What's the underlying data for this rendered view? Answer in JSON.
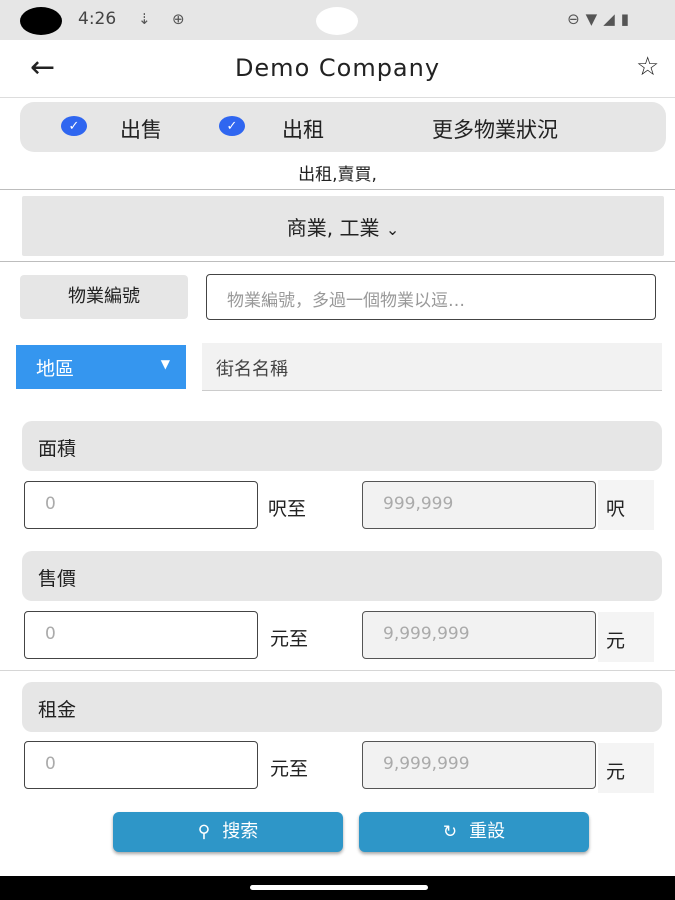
{
  "status_bar": {
    "time": "4:26",
    "icons_left": [
      "download-icon",
      "vpn-icon"
    ],
    "icons_right": [
      "dnd-icon",
      "wifi-icon",
      "signal-icon",
      "battery-icon"
    ]
  },
  "app_bar": {
    "title": "Demo Company",
    "back_icon": "arrow-back-icon",
    "star_icon": "star-outline-icon"
  },
  "type_bar": {
    "option1": "出售",
    "option2": "出租",
    "more": "更多物業狀況"
  },
  "selected_status": "出租,賣買,",
  "usage": {
    "label": "商業, 工業",
    "icon": "chevron-down-icon"
  },
  "property_id": {
    "button": "物業編號",
    "placeholder": "物業編號，多過一個物業以逗…"
  },
  "district": {
    "selected": "地區",
    "street_placeholder": "街名名稱"
  },
  "area": {
    "label": "面積",
    "min_placeholder": "0",
    "to_unit": "呎至",
    "max_placeholder": "999,999",
    "unit": "呎"
  },
  "price": {
    "label": "售價",
    "min_placeholder": "0",
    "to_unit": "元至",
    "max_placeholder": "9,999,999",
    "unit": "元"
  },
  "rent": {
    "label": "租金",
    "min_placeholder": "0",
    "to_unit": "元至",
    "max_placeholder": "9,999,999",
    "unit": "元"
  },
  "buttons": {
    "search": "搜索",
    "reset": "重設"
  },
  "colors": {
    "accent_blue": "#2f66f0",
    "district_blue": "#3596ef",
    "button_blue": "#2e96c8"
  }
}
